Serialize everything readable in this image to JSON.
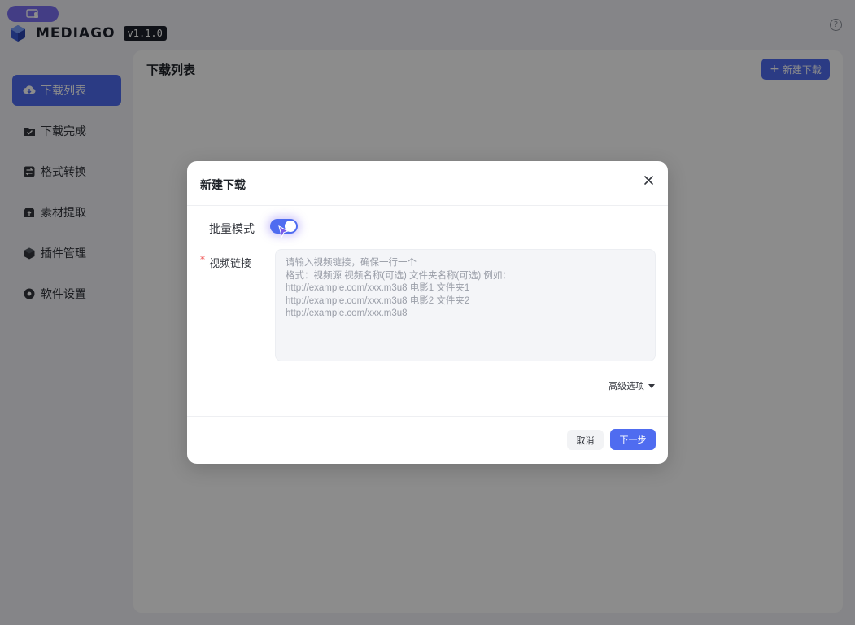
{
  "app": {
    "brand": "MEDIAGO",
    "version": "v1.1.0",
    "help_symbol": "?"
  },
  "sidebar": {
    "items": [
      {
        "label": "下载列表",
        "icon": "cloud-download-icon",
        "active": true
      },
      {
        "label": "下载完成",
        "icon": "folder-check-icon",
        "active": false
      },
      {
        "label": "格式转换",
        "icon": "convert-icon",
        "active": false
      },
      {
        "label": "素材提取",
        "icon": "extract-icon",
        "active": false
      },
      {
        "label": "插件管理",
        "icon": "plugin-box-icon",
        "active": false
      },
      {
        "label": "软件设置",
        "icon": "settings-icon",
        "active": false
      }
    ]
  },
  "main": {
    "title": "下载列表",
    "new_button": "新建下载",
    "new_button_icon": "+"
  },
  "modal": {
    "title": "新建下载",
    "batch_mode_label": "批量模式",
    "batch_mode_on": true,
    "video_link_label": "视频链接",
    "required_mark": "*",
    "textarea_value": "",
    "textarea_placeholder": "请输入视频链接，确保一行一个\n格式：视频源 视频名称(可选) 文件夹名称(可选) 例如：\nhttp://example.com/xxx.m3u8 电影1 文件夹1\nhttp://example.com/xxx.m3u8 电影2 文件夹2\nhttp://example.com/xxx.m3u8",
    "advanced_label": "高级选项",
    "cancel_label": "取消",
    "next_label": "下一步"
  },
  "colors": {
    "accent": "#4f6cf0",
    "pill": "#7b6ff2",
    "required": "#f04b4b"
  }
}
